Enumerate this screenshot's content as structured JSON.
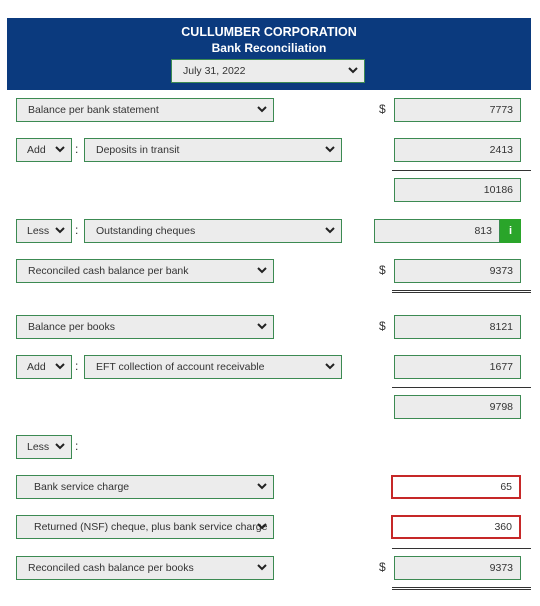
{
  "header": {
    "company": "CULLUMBER CORPORATION",
    "title": "Bank Reconciliation",
    "date_selected": "July 31, 2022"
  },
  "bank": {
    "balance_label": "Balance per bank statement",
    "balance_amount": "7773",
    "add_op": "Add",
    "add_item": "Deposits in transit",
    "add_amount": "2413",
    "subtotal": "10186",
    "less_op": "Less",
    "less_item": "Outstanding cheques",
    "less_amount": "813",
    "reconciled_label": "Reconciled cash balance per bank",
    "reconciled_amount": "9373"
  },
  "books": {
    "balance_label": "Balance per books",
    "balance_amount": "8121",
    "add_op": "Add",
    "add_item": "EFT collection of account receivable",
    "add_amount": "1677",
    "subtotal": "9798",
    "less_op": "Less",
    "less_item1": "Bank service charge",
    "less_amount1": "65",
    "less_item2": "Returned (NSF) cheque, plus bank service charge",
    "less_amount2": "360",
    "reconciled_label": "Reconciled cash balance per books",
    "reconciled_amount": "9373"
  },
  "symbols": {
    "currency": "$",
    "colon": ":",
    "info": "i"
  },
  "colors": {
    "header_bg": "#0b3a7e",
    "field_border": "#3c8a52",
    "error_border": "#c62828",
    "info_green": "#2aa52a"
  }
}
